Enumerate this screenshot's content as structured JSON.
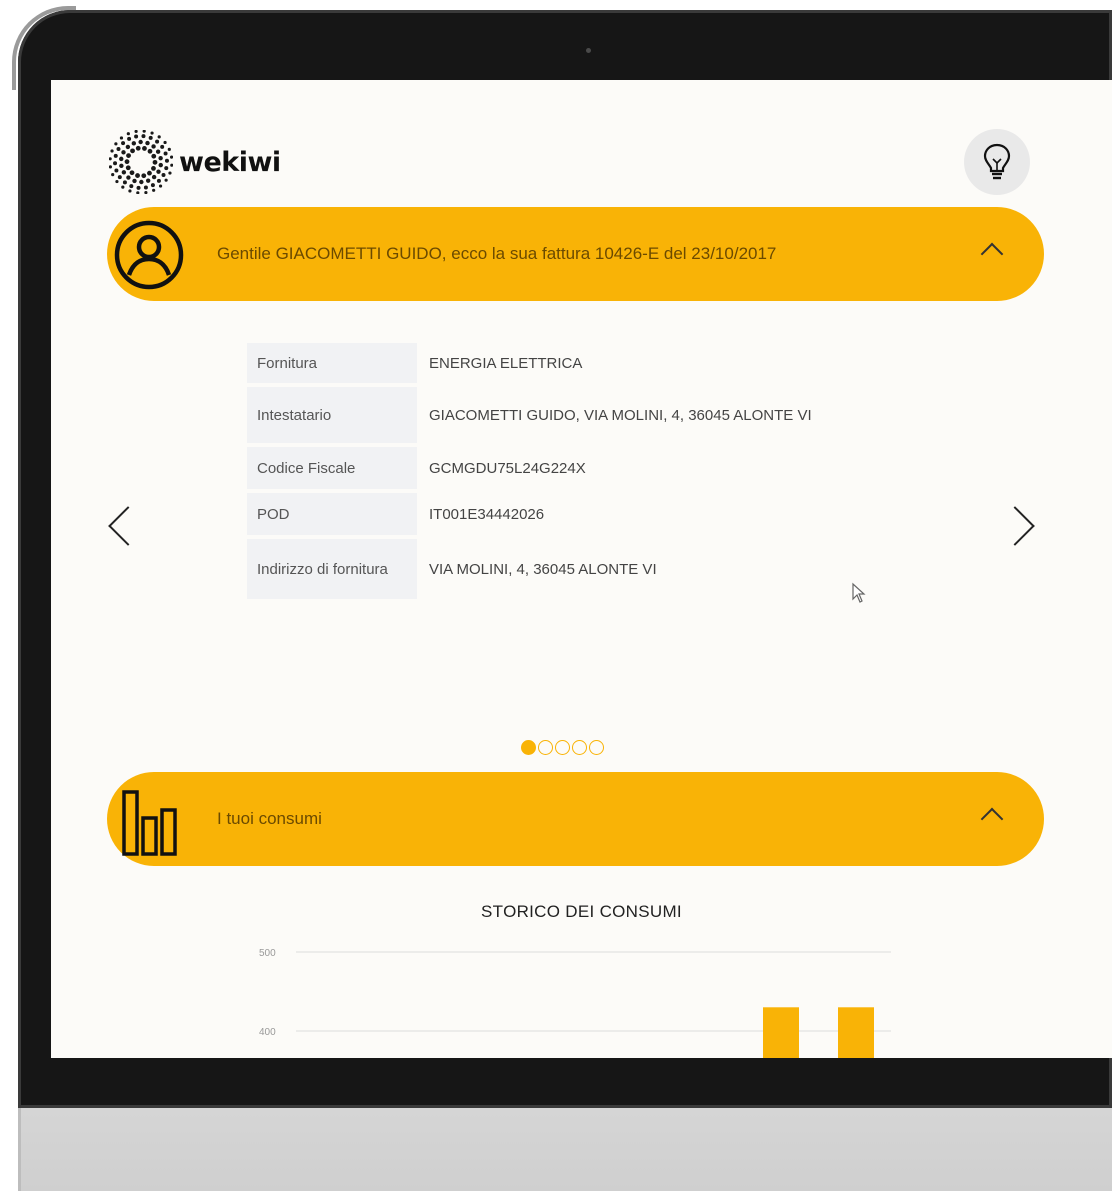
{
  "brand": {
    "name": "wekiwi"
  },
  "invoice_section": {
    "greeting": "Gentile GIACOMETTI GUIDO, ecco la sua fattura 10426-E del 23/10/2017",
    "rows": [
      {
        "label": "Fornitura",
        "value": "ENERGIA ELETTRICA"
      },
      {
        "label": "Intestatario",
        "value": "GIACOMETTI GUIDO, VIA MOLINI, 4, 36045 ALONTE VI"
      },
      {
        "label": "Codice Fiscale",
        "value": "GCMGDU75L24G224X"
      },
      {
        "label": "POD",
        "value": "IT001E34442026"
      },
      {
        "label": "Indirizzo di fornitura",
        "value": "VIA MOLINI, 4, 36045 ALONTE VI"
      }
    ],
    "carousel": {
      "total_slides": 5,
      "active_slide": 1
    }
  },
  "consumi_section": {
    "title": "I tuoi consumi"
  },
  "colors": {
    "accent": "#f9b306",
    "background": "#fcfbf8",
    "text": "#444444"
  },
  "icons": [
    "light-bulb-icon",
    "user-circle-icon",
    "bar-chart-icon",
    "chevron-up-icon",
    "chevron-left-icon",
    "chevron-right-icon",
    "cursor-icon"
  ],
  "chart_data": {
    "type": "bar",
    "title": "STORICO DEI CONSUMI",
    "y_ticks": [
      500,
      400
    ],
    "ylim_visible": [
      400,
      500
    ],
    "grid": true,
    "values_visible_above": [
      430,
      430
    ],
    "note_values": "only the top of two bars is visible above the 400 gridline; values are partially cut off"
  }
}
